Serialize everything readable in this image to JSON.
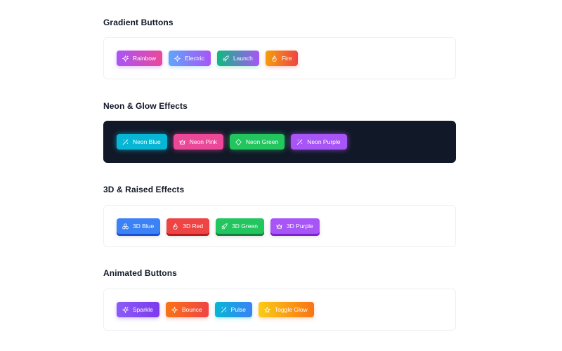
{
  "sections": [
    {
      "title": "Gradient Buttons",
      "buttons": [
        {
          "label": "Rainbow",
          "icon": "sparkles-icon"
        },
        {
          "label": "Electric",
          "icon": "zap-icon"
        },
        {
          "label": "Launch",
          "icon": "rocket-icon"
        },
        {
          "label": "Fire",
          "icon": "flame-icon"
        }
      ]
    },
    {
      "title": "Neon & Glow Effects",
      "buttons": [
        {
          "label": "Neon Blue",
          "icon": "wand-icon"
        },
        {
          "label": "Neon Pink",
          "icon": "crown-icon"
        },
        {
          "label": "Neon Green",
          "icon": "diamond-icon"
        },
        {
          "label": "Neon Purple",
          "icon": "wand-icon"
        }
      ]
    },
    {
      "title": "3D & Raised Effects",
      "buttons": [
        {
          "label": "3D Blue",
          "icon": "shapes-icon"
        },
        {
          "label": "3D Red",
          "icon": "flame-icon"
        },
        {
          "label": "3D Green",
          "icon": "rocket-icon"
        },
        {
          "label": "3D Purple",
          "icon": "crown-icon"
        }
      ]
    },
    {
      "title": "Animated Buttons",
      "buttons": [
        {
          "label": "Sparkle",
          "icon": "sparkles-icon"
        },
        {
          "label": "Bounce",
          "icon": "zap-icon"
        },
        {
          "label": "Pulse",
          "icon": "wand-icon"
        },
        {
          "label": "Toggle Glow",
          "icon": "star-icon"
        }
      ]
    }
  ],
  "colors": {
    "dark_card_bg": "#111827",
    "title_text": "#111827",
    "card_border": "#eef0f3"
  }
}
